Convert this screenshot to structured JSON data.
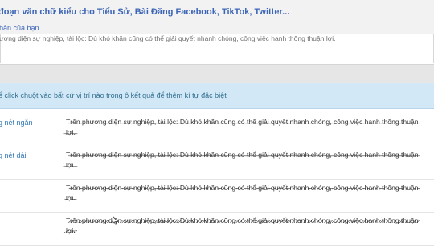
{
  "header": {
    "title": "đoạn văn chữ kiểu cho Tiểu Sử, Bài Đăng Facebook, TikTok, Twitter...",
    "input_label": "bản của bạn"
  },
  "input": {
    "text": "ương diện sự nghiệp, tài lộc: Dù khó khăn cũng có thể giải quyết nhanh chóng, công việc hanh thông thuận lợi."
  },
  "info_bar": {
    "text": "ể click chuột vào bất cứ vị trí nào trong ô kết quả để thêm kí tự đặc biệt"
  },
  "results": [
    {
      "label": "g nét ngắn",
      "value": "T̶r̶ê̶n̶ ̶p̶h̶ư̶ơ̶n̶g̶ ̶d̶i̶ệ̶n̶ ̶s̶ự̶ ̶n̶g̶h̶i̶ệ̶p̶,̶ ̶t̶à̶i̶ ̶l̶ộ̶c̶:̶ ̶D̶ù̶ ̶k̶h̶ó̶ ̶k̶h̶ă̶n̶ ̶c̶ũ̶n̶g̶ ̶c̶ó̶ ̶t̶h̶ể̶ ̶g̶i̶ả̶i̶ ̶q̶u̶y̶ế̶t̶ ̶n̶h̶a̶n̶h̶ ̶c̶h̶ó̶n̶g̶,̶ ̶c̶ô̶n̶g̶ ̶v̶i̶ệ̶c̶ ̶h̶a̶n̶h̶ ̶t̶h̶ô̶n̶g̶ ̶t̶h̶u̶ậ̶n̶ ̶l̶ợ̶i̶.̶"
    },
    {
      "label": "g nét dài",
      "value": "T̶r̶ê̶n̶ ̶p̶h̶ư̶ơ̶n̶g̶ ̶d̶i̶ệ̶n̶ ̶s̶ự̶ ̶n̶g̶h̶i̶ệ̶p̶,̶ ̶t̶à̶i̶ ̶l̶ộ̶c̶:̶ ̶D̶ù̶ ̶k̶h̶ó̶ ̶k̶h̶ă̶n̶ ̶c̶ũ̶n̶g̶ ̶c̶ó̶ ̶t̶h̶ể̶ ̶g̶i̶ả̶i̶ ̶q̶u̶y̶ế̶t̶ ̶n̶h̶a̶n̶h̶ ̶c̶h̶ó̶n̶g̶,̶ ̶c̶ô̶n̶g̶ ̶v̶i̶ệ̶c̶ ̶h̶a̶n̶h̶ ̶t̶h̶ô̶n̶g̶ ̶t̶h̶u̶ậ̶n̶ ̶l̶ợ̶i̶.̶"
    },
    {
      "label": "",
      "value": "T̴r̴ê̴n̴ ̴p̴h̴ư̴ơ̴n̴g̴ ̴d̴i̴ệ̴n̴ ̴s̴ự̴ ̴n̴g̴h̴i̴ệ̴p̴,̴ ̴t̴à̴i̴ ̴l̴ộ̴c̴:̴ ̴D̴ù̴ ̴k̴h̴ó̴ ̴k̴h̴ă̴n̴ ̴c̴ũ̴n̴g̴ ̴c̴ó̴ ̴t̴h̴ể̴ ̴g̴i̴ả̴i̴ ̴q̴u̴y̴ế̴t̴ ̴n̴h̴a̴n̴h̴ ̴c̴h̴ó̴n̴g̴,̴ ̴c̴ô̴n̴g̴ ̴v̴i̴ệ̴c̴ ̴h̴a̴n̴h̴ ̴t̴h̴ô̴n̴g̴ ̴t̴h̴u̴ậ̴n̴ ̴l̴ợ̴i̴.̴"
    },
    {
      "label": "",
      "value": "T̷r̷ê̷n̷ ̷p̷h̷ư̷ơ̷n̷g̷ ̷d̷i̷ệ̷n̷ ̷s̷ự̷ ̷n̷g̷h̷i̷ệ̷p̷,̷ ̷t̷à̷i̷ ̷l̷ộ̷c̷:̷ ̷D̷ù̷ ̷k̷h̷ó̷ ̷k̷h̷ă̷n̷ ̷c̷ũ̷n̷g̷ ̷c̷ó̷ ̷t̷h̷ể̷ ̷g̷i̷ả̷i̷ ̷q̷u̷y̷ế̷t̷ ̷n̷h̷a̷n̷h̷ ̷c̷h̷ó̷n̷g̷,̷ ̷c̷ô̷n̷g̷ ̷v̷i̷ệ̷c̷ ̷h̷a̷n̷h̷ ̷t̷h̷ô̷n̷g̷ ̷t̷h̷u̷ậ̷n̷ ̷l̷ợ̷i̷.̷"
    }
  ],
  "colors": {
    "link_blue": "#3d66b7",
    "info_bg": "#d3e8f7",
    "info_text": "#31708f",
    "header_bg": "#f2f2f2"
  },
  "icons": {
    "cursor": "mouse-pointer-icon"
  }
}
